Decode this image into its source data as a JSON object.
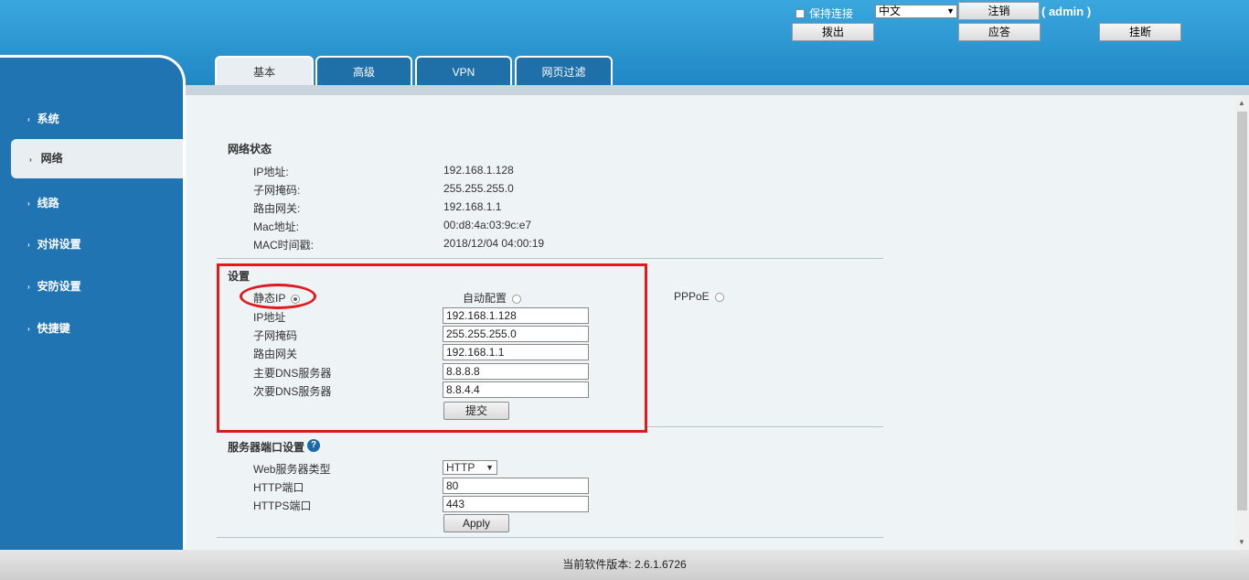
{
  "header": {
    "keep_connected": "保持连接",
    "language": "中文",
    "logout": "注销",
    "user": "( admin )",
    "dial": "拨出",
    "answer": "应答",
    "hangup": "挂断"
  },
  "tabs": [
    "基本",
    "高级",
    "VPN",
    "网页过滤"
  ],
  "sidebar": {
    "items": [
      "系统",
      "网络",
      "线路",
      "对讲设置",
      "安防设置",
      "快捷键"
    ]
  },
  "status": {
    "title": "网络状态",
    "rows": [
      {
        "label": "IP地址:",
        "value": "192.168.1.128"
      },
      {
        "label": "子网掩码:",
        "value": "255.255.255.0"
      },
      {
        "label": "路由网关:",
        "value": "192.168.1.1"
      },
      {
        "label": "Mac地址:",
        "value": "00:d8:4a:03:9c:e7"
      },
      {
        "label": "MAC时间戳:",
        "value": "2018/12/04 04:00:19"
      }
    ]
  },
  "settings": {
    "title": "设置",
    "mode_static": "静态IP",
    "mode_dhcp": "自动配置",
    "mode_pppoe": "PPPoE",
    "fields": [
      {
        "label": "IP地址",
        "value": "192.168.1.128"
      },
      {
        "label": "子网掩码",
        "value": "255.255.255.0"
      },
      {
        "label": "路由网关",
        "value": "192.168.1.1"
      },
      {
        "label": "主要DNS服务器",
        "value": "8.8.8.8"
      },
      {
        "label": "次要DNS服务器",
        "value": "8.8.4.4"
      }
    ],
    "submit": "提交"
  },
  "server": {
    "title": "服务器端口设置",
    "help": "?",
    "web_type_label": "Web服务器类型",
    "web_type_value": "HTTP",
    "http_label": "HTTP端口",
    "http_value": "80",
    "https_label": "HTTPS端口",
    "https_value": "443",
    "apply": "Apply"
  },
  "footer": {
    "version": "当前软件版本: 2.6.1.6726"
  }
}
